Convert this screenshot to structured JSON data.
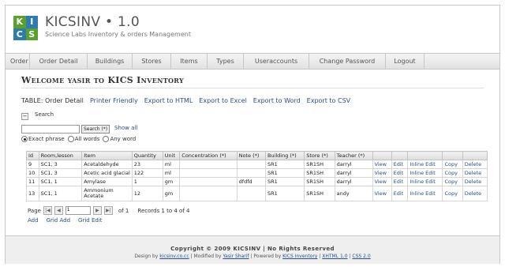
{
  "header": {
    "logo_letters": [
      "K",
      "I",
      "C",
      "S"
    ],
    "title": "KICSINV • 1.0",
    "subtitle": "Science Labs Inventory & orders Management"
  },
  "nav": [
    "Order",
    "Order Detail",
    "Buildings",
    "Stores",
    "Items",
    "Types",
    "Useraccounts",
    "Change Password",
    "Logout"
  ],
  "welcome": "Welcome yasir to KICS Inventory",
  "table_caption": "TABLE: Order Detail",
  "exports": [
    "Printer Friendly",
    "Export to HTML",
    "Export to Excel",
    "Export to Word",
    "Export to CSV"
  ],
  "search": {
    "toggle": "−",
    "label": "Search",
    "value": "",
    "button": "Search (*)",
    "show_all": "Show all",
    "options": [
      "Exact phrase",
      "All words",
      "Any word"
    ],
    "selected": "Exact phrase"
  },
  "table": {
    "columns": [
      "Id",
      "Room,lesson",
      "Item",
      "Quantity",
      "Unit",
      "Concentration (*)",
      "Note (*)",
      "Building (*)",
      "Store (*)",
      "Teacher (*)"
    ],
    "actions": [
      "View",
      "Edit",
      "Inline Edit",
      "Copy",
      "Delete"
    ],
    "rows": [
      [
        "9",
        "SC1, 3",
        "Acetaldehyde",
        "23",
        "ml",
        "",
        "",
        "SR1",
        "SR1SH",
        "darryl"
      ],
      [
        "10",
        "SC1, 3",
        "Acetic acid glacial",
        "122",
        "ml",
        "",
        "",
        "SR1",
        "SR1SH",
        "darryl"
      ],
      [
        "11",
        "SC1, 1",
        "Amylase",
        "1",
        "gm",
        "",
        "dfdfd",
        "SR1",
        "SR1SH",
        "darryl"
      ],
      [
        "13",
        "SC1, 1",
        "Ammonium Acetate",
        "12",
        "gm",
        "",
        "",
        "SR1",
        "SR1SH",
        "andy"
      ]
    ]
  },
  "pager": {
    "label": "Page",
    "current": "1",
    "of": "of 1",
    "records": "Records 1 to 4 of 4"
  },
  "add_links": [
    "Add",
    "Grid Add",
    "Grid Edit"
  ],
  "footer": {
    "copyright": "Copyright © 2009 KICSINV | No Rights Reserved",
    "design_prefix": "Design by",
    "design_link": "kicsinv.co.cc",
    "modified_prefix": "| Modified by",
    "modified_link": "Yasir Sharif",
    "powered_prefix": "| Powered by",
    "powered_link": "KICS Inventory",
    "sep": "|",
    "xhtml": "XHTML 1.0",
    "css": "CSS 2.0"
  },
  "colors": {
    "link": "#2a4f8a",
    "logo_green": "#5aa02c",
    "logo_blue": "#2e7bb0"
  }
}
